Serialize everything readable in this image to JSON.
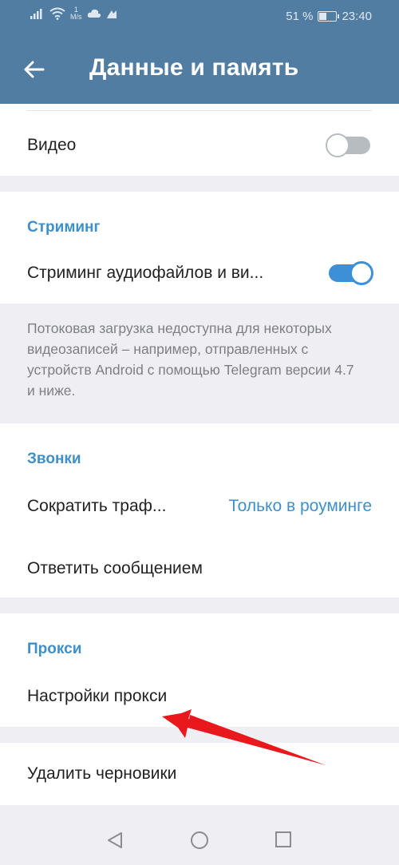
{
  "status_bar": {
    "speed_value": "1",
    "speed_unit": "M/s",
    "battery_percent": "51 %",
    "battery_level": 0.51,
    "time": "23:40"
  },
  "app_bar": {
    "title": "Данные и память"
  },
  "media": {
    "video_label": "Видео",
    "video_enabled": false
  },
  "streaming": {
    "section_title": "Стриминг",
    "stream_label": "Стриминг аудиофайлов и ви...",
    "stream_enabled": true,
    "info_text": "Потоковая загрузка недоступна для некоторых видеозаписей – например, отправленных с устройств Android с помощью Telegram версии 4.7 и ниже."
  },
  "calls": {
    "section_title": "Звонки",
    "reduce_traffic_label": "Сократить траф...",
    "reduce_traffic_value": "Только в роуминге",
    "reply_label": "Ответить сообщением"
  },
  "proxy": {
    "section_title": "Прокси",
    "settings_label": "Настройки прокси"
  },
  "drafts": {
    "delete_label": "Удалить черновики"
  },
  "colors": {
    "header": "#527da3",
    "accent": "#3f8fc9",
    "toggle_on": "#3d8fd6",
    "annotation": "#e8181c"
  }
}
